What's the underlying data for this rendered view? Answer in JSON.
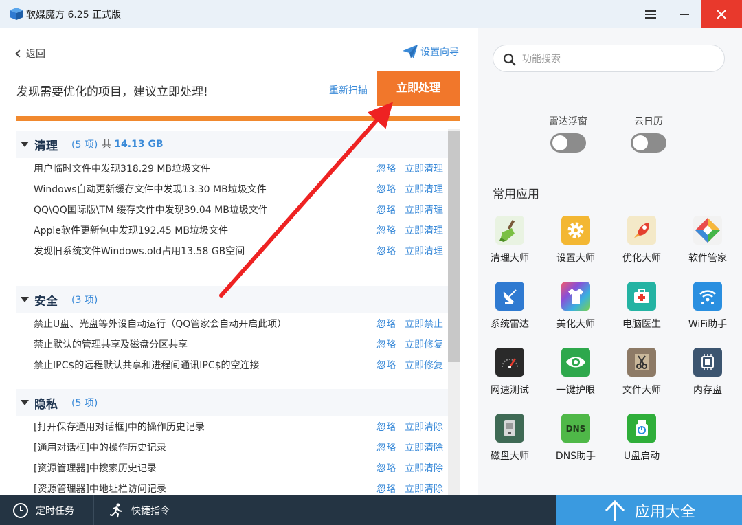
{
  "window": {
    "title": "软媒魔方 6.25 正式版"
  },
  "nav": {
    "back_label": "返回",
    "guide_label": "设置向导"
  },
  "scan": {
    "headline": "发现需要优化的项目，建议立即处理!",
    "rescan_label": "重新扫描",
    "process_label": "立即处理"
  },
  "sections": [
    {
      "title": "清理",
      "count": "(5 项)",
      "total_prefix": "共",
      "total_size": "14.13 GB",
      "items": [
        {
          "text": "用户临时文件中发现318.29 MB垃圾文件",
          "ignore": "忽略",
          "action": "立即清理"
        },
        {
          "text": "Windows自动更新缓存文件中发现13.30 MB垃圾文件",
          "ignore": "忽略",
          "action": "立即清理"
        },
        {
          "text": "QQ\\QQ国际版\\TM 缓存文件中发现39.04 MB垃圾文件",
          "ignore": "忽略",
          "action": "立即清理"
        },
        {
          "text": "Apple软件更新包中发现192.45 MB垃圾文件",
          "ignore": "忽略",
          "action": "立即清理"
        },
        {
          "text": "发现旧系统文件Windows.old占用13.58 GB空间",
          "ignore": "忽略",
          "action": "立即清理"
        }
      ]
    },
    {
      "title": "安全",
      "count": "(3 项)",
      "items": [
        {
          "text": "禁止U盘、光盘等外设自动运行（QQ管家会自动开启此项）",
          "ignore": "忽略",
          "action": "立即禁止"
        },
        {
          "text": "禁止默认的管理共享及磁盘分区共享",
          "ignore": "忽略",
          "action": "立即修复"
        },
        {
          "text": "禁止IPC$的远程默认共享和进程间通讯IPC$的空连接",
          "ignore": "忽略",
          "action": "立即修复"
        }
      ]
    },
    {
      "title": "隐私",
      "count": "(5 项)",
      "items": [
        {
          "text": "[打开保存通用对话框]中的操作历史记录",
          "ignore": "忽略",
          "action": "立即清除"
        },
        {
          "text": "[通用对话框]中的操作历史记录",
          "ignore": "忽略",
          "action": "立即清除"
        },
        {
          "text": "[资源管理器]中搜索历史记录",
          "ignore": "忽略",
          "action": "立即清除"
        },
        {
          "text": "[资源管理器]中地址栏访问记录",
          "ignore": "忽略",
          "action": "立即清除"
        }
      ]
    }
  ],
  "search": {
    "placeholder": "功能搜索"
  },
  "toggles": [
    {
      "label": "雷达浮窗",
      "on": false
    },
    {
      "label": "云日历",
      "on": false
    }
  ],
  "apps": {
    "title": "常用应用",
    "items": [
      {
        "name": "清理大师",
        "icon": "broom-icon",
        "color": "#e9f3e2"
      },
      {
        "name": "设置大师",
        "icon": "gear-icon",
        "color": "#f3b733"
      },
      {
        "name": "优化大师",
        "icon": "rocket-icon",
        "color": "#f4e9c8"
      },
      {
        "name": "软件管家",
        "icon": "diamond-icon",
        "color": "#f2f2f2"
      },
      {
        "name": "系统雷达",
        "icon": "radar-dish-icon",
        "color": "#2f7ad1"
      },
      {
        "name": "美化大师",
        "icon": "tshirt-icon",
        "color": "#7a4fd6"
      },
      {
        "name": "电脑医生",
        "icon": "medkit-icon",
        "color": "#24b3a3"
      },
      {
        "name": "WiFi助手",
        "icon": "wifi-icon",
        "color": "#2a8fe0"
      },
      {
        "name": "网速测试",
        "icon": "speedometer-icon",
        "color": "#2a2a2a"
      },
      {
        "name": "一键护眼",
        "icon": "eye-icon",
        "color": "#2ea84c"
      },
      {
        "name": "文件大师",
        "icon": "scissors-icon",
        "color": "#8d7a66"
      },
      {
        "name": "内存盘",
        "icon": "chip-icon",
        "color": "#3c5570"
      },
      {
        "name": "磁盘大师",
        "icon": "disk-icon",
        "color": "#3f6a55"
      },
      {
        "name": "DNS助手",
        "icon": "dns-icon",
        "color": "#4fb848"
      },
      {
        "name": "U盘启动",
        "icon": "usb-icon",
        "color": "#2fae3a"
      }
    ]
  },
  "bottom": {
    "scheduled_label": "定时任务",
    "shortcut_label": "快捷指令",
    "all_apps_label": "应用大全"
  },
  "colors": {
    "accent_orange": "#f1772b",
    "link_blue": "#3a8ad8",
    "bottom_bar": "#243443",
    "all_apps_blue": "#3a9ae0",
    "close_red": "#e8392c",
    "annotation_arrow": "#ee2222"
  }
}
